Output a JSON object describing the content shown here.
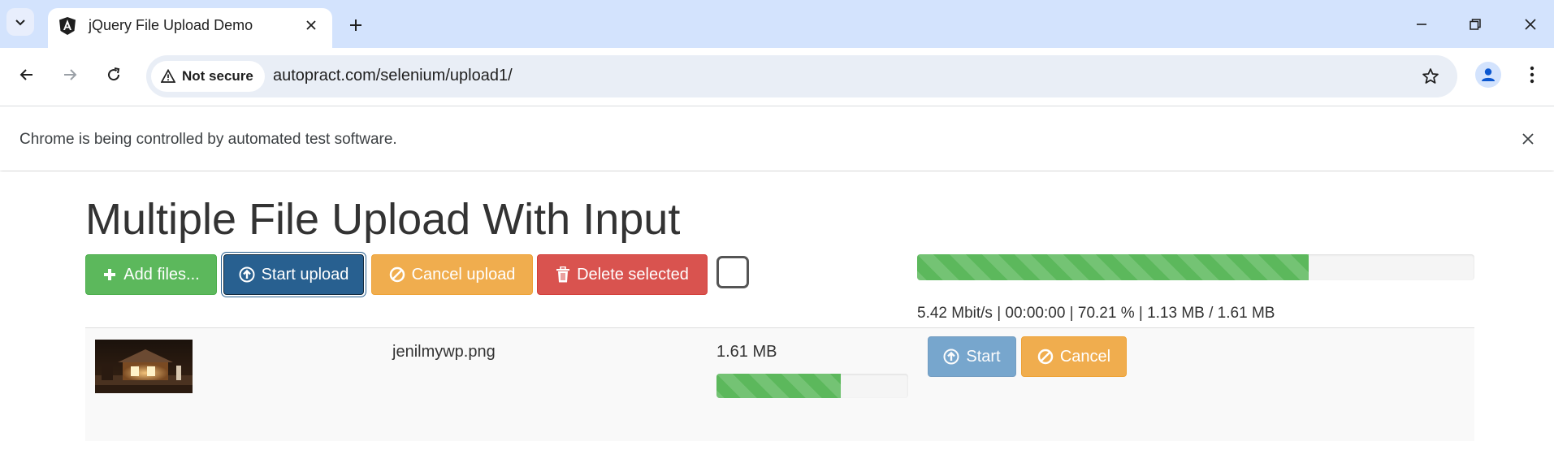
{
  "browser": {
    "tab_title": "jQuery File Upload Demo",
    "security_label": "Not secure",
    "url": "autopract.com/selenium/upload1/",
    "infobar_text": "Chrome is being controlled by automated test software."
  },
  "page": {
    "title": "Multiple File Upload With Input",
    "buttons": {
      "add_files": "Add files...",
      "start_upload": "Start upload",
      "cancel_upload": "Cancel upload",
      "delete_selected": "Delete selected"
    },
    "global_progress": {
      "percent": 70.21,
      "text": "5.42 Mbit/s | 00:00:00 | 70.21 % | 1.13 MB / 1.61 MB"
    },
    "files": [
      {
        "name": "jenilmywp.png",
        "size": "1.61 MB",
        "progress_percent": 65,
        "start_label": "Start",
        "cancel_label": "Cancel"
      }
    ]
  },
  "colors": {
    "success": "#5cb85c",
    "primary": "#337ab7",
    "warning": "#f0ad4e",
    "danger": "#d9534f",
    "tabstrip": "#d3e3fd"
  }
}
